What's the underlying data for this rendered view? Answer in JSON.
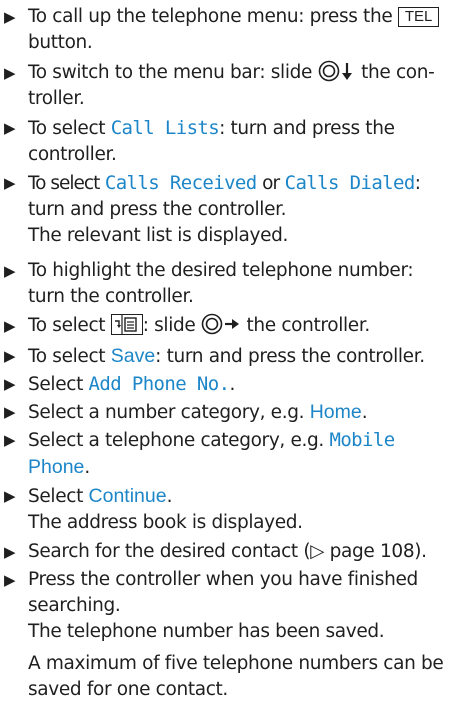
{
  "steps": [
    {
      "pre": "To call up the telephone menu: press the",
      "key": "TEL",
      "post": "button."
    },
    {
      "pre": "To switch to the menu bar: slide",
      "post": "the con-",
      "line2": "troller."
    },
    {
      "pre": "To select",
      "ui": "Call Lists",
      "post": ": turn and press the",
      "line2": "controller."
    },
    {
      "pre": "To select",
      "ui1": "Calls Received",
      "mid": "or",
      "ui2": "Calls Dialed",
      "post": ":",
      "line2": "turn and press the controller.",
      "result": "The relevant list is displayed."
    },
    {
      "text": "To highlight the desired telephone number:",
      "line2": "turn the controller."
    },
    {
      "pre": "To select",
      "mid": ": slide",
      "post": "the controller."
    },
    {
      "pre": "To select",
      "ui": "Save",
      "post": ": turn and press the controller."
    },
    {
      "pre": "Select",
      "ui": "Add Phone No.",
      "post": "."
    },
    {
      "pre": "Select a number category, e.g.",
      "ui": "Home",
      "post": "."
    },
    {
      "pre": "Select a telephone category, e.g.",
      "ui": "Mobile",
      "ui2": "Phone",
      "post": "."
    },
    {
      "pre": "Select",
      "ui": "Continue",
      "post": ".",
      "result": "The address book is displayed."
    },
    {
      "text": "Search for the desired contact (▷ page 108)."
    },
    {
      "text": "Press the controller when you have finished",
      "line2": "searching.",
      "result": "The telephone number has been saved.",
      "note": "A maximum of five telephone numbers can be",
      "note2": "saved for one contact."
    }
  ],
  "icons": {
    "bullet": "bullet-triangle-icon",
    "controller": "controller-icon",
    "phonebook": "store-number-icon"
  },
  "colors": {
    "ui_text": "#1c86c8",
    "body_text": "#1f1f1f"
  }
}
